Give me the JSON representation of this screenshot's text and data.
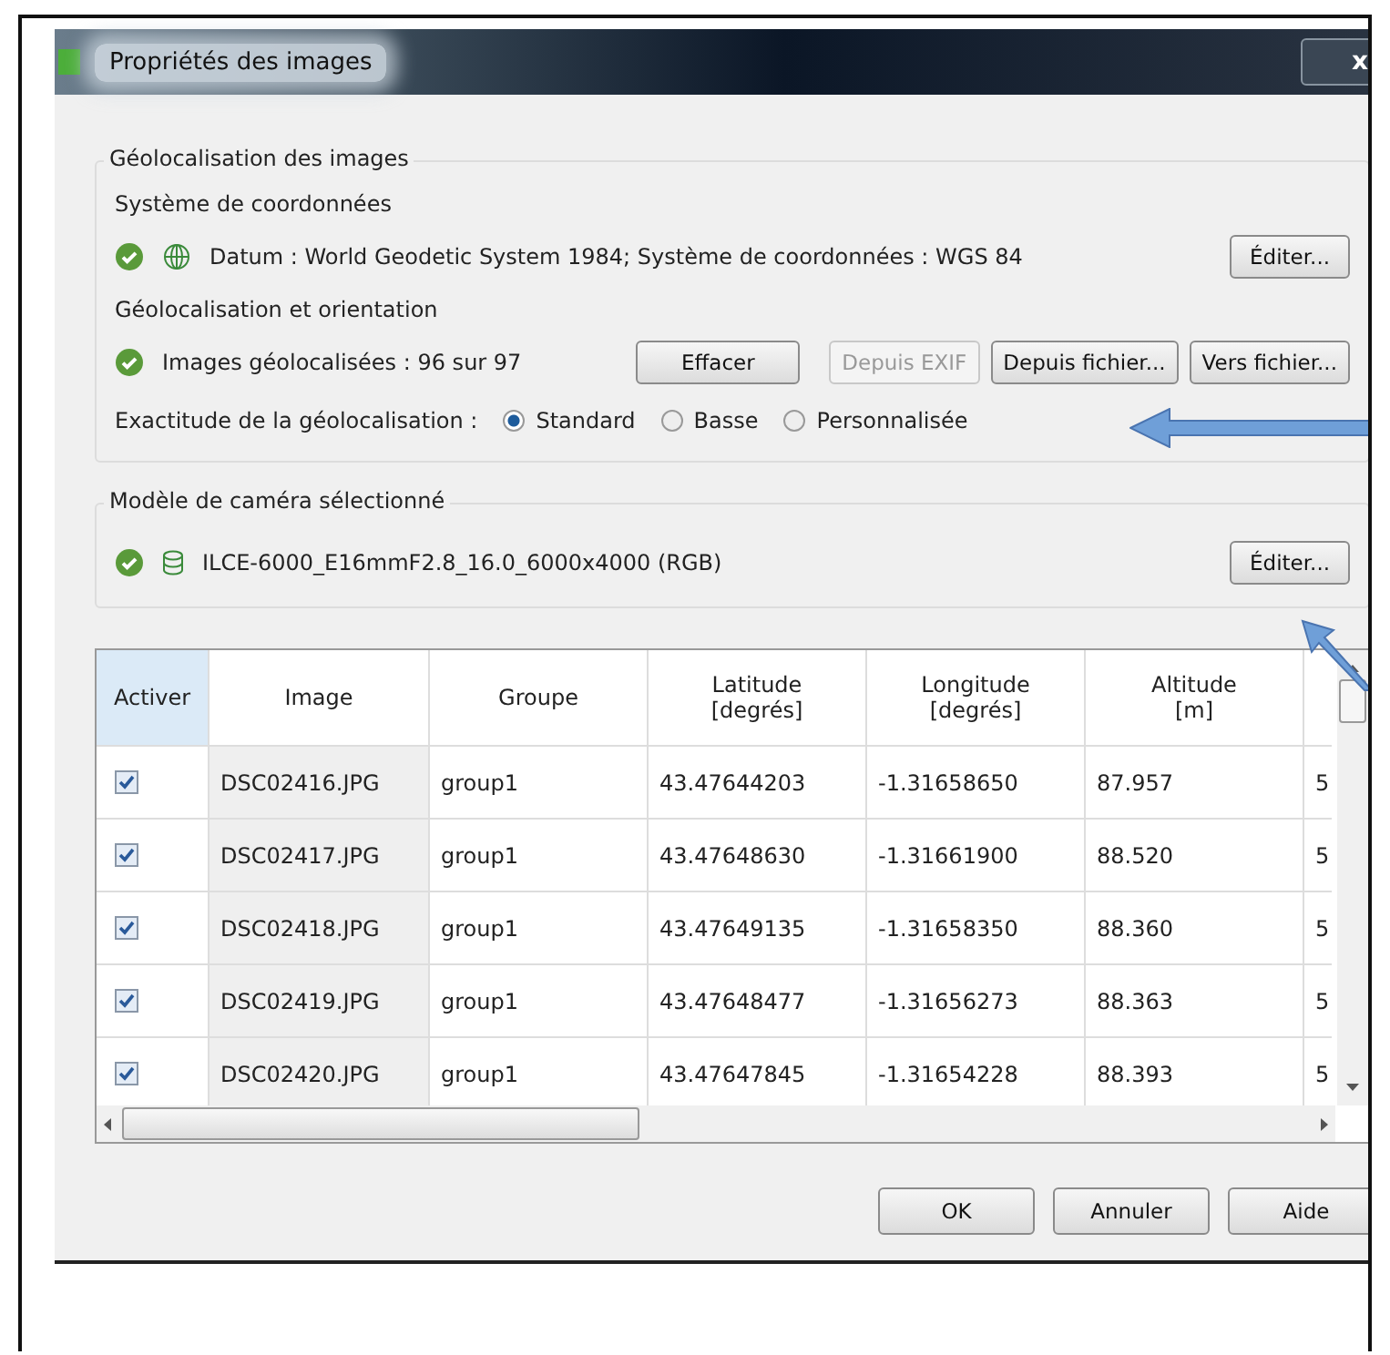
{
  "window": {
    "title": "Propriétés des images",
    "close": "x"
  },
  "geolocation": {
    "title": "Géolocalisation des images",
    "coord_label": "Système de coordonnées",
    "datum": "Datum : World Geodetic System 1984; Système de coordonnées : WGS 84",
    "datum_ok": true,
    "datum_button": "Éditer...",
    "orient_label": "Géolocalisation et orientation",
    "status": "Images géolocalisées : 96 sur 97",
    "status_ok": true,
    "buttons": [
      {
        "label": "Effacer",
        "disabled": false
      },
      {
        "label": "Depuis EXIF",
        "disabled": true
      },
      {
        "label": "Depuis fichier...",
        "disabled": false
      },
      {
        "label": "Vers fichier...",
        "disabled": false
      }
    ],
    "accuracy_label": "Exactitude de la géolocalisation :",
    "accuracy": [
      {
        "label": "Standard",
        "selected": true
      },
      {
        "label": "Basse",
        "selected": false
      },
      {
        "label": "Personnalisée",
        "selected": false
      }
    ]
  },
  "camera": {
    "title": "Modèle de caméra sélectionné",
    "model": "ILCE-6000_E16mmF2.8_16.0_6000x4000 (RGB)",
    "model_ok": true,
    "button": "Éditer..."
  },
  "table": {
    "check_column": "Activer",
    "columns": [
      "Image",
      "Groupe",
      "Latitude\n[degrés]",
      "Longitude\n[degrés]",
      "Altitude\n[m]"
    ],
    "rows": [
      {
        "checked": true,
        "cells": [
          "DSC02416.JPG",
          "group1",
          "43.47644203",
          "-1.31658650",
          "87.957",
          "5"
        ]
      },
      {
        "checked": true,
        "cells": [
          "DSC02417.JPG",
          "group1",
          "43.47648630",
          "-1.31661900",
          "88.520",
          "5"
        ]
      },
      {
        "checked": true,
        "cells": [
          "DSC02418.JPG",
          "group1",
          "43.47649135",
          "-1.31658350",
          "88.360",
          "5"
        ]
      },
      {
        "checked": true,
        "cells": [
          "DSC02419.JPG",
          "group1",
          "43.47648477",
          "-1.31656273",
          "88.363",
          "5"
        ]
      },
      {
        "checked": true,
        "cells": [
          "DSC02420.JPG",
          "group1",
          "43.47647845",
          "-1.31654228",
          "88.393",
          "5"
        ]
      }
    ]
  },
  "footer_buttons": [
    "OK",
    "Annuler",
    "Aide"
  ]
}
